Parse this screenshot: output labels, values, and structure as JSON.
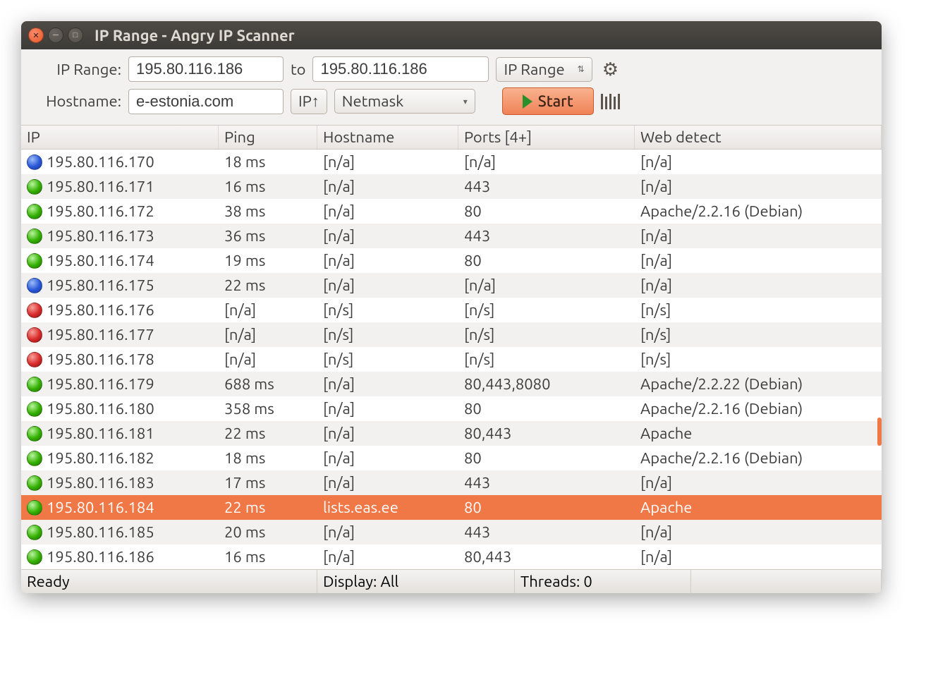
{
  "window": {
    "title": "IP Range - Angry IP Scanner"
  },
  "toolbar": {
    "ip_range_label": "IP Range:",
    "ip_from": "195.80.116.186",
    "to_label": "to",
    "ip_to": "195.80.116.186",
    "mode_select": "IP Range",
    "hostname_label": "Hostname:",
    "hostname": "e-estonia.com",
    "ip_up_label": "IP↑",
    "netmask_select": "Netmask",
    "start_label": "Start"
  },
  "columns": [
    "IP",
    "Ping",
    "Hostname",
    "Ports [4+]",
    "Web detect"
  ],
  "rows": [
    {
      "status": "blue",
      "ip": "195.80.116.170",
      "ping": "18 ms",
      "host": "[n/a]",
      "ports": "[n/a]",
      "web": "[n/a]",
      "selected": false
    },
    {
      "status": "green",
      "ip": "195.80.116.171",
      "ping": "16 ms",
      "host": "[n/a]",
      "ports": "443",
      "web": "[n/a]",
      "selected": false
    },
    {
      "status": "green",
      "ip": "195.80.116.172",
      "ping": "38 ms",
      "host": "[n/a]",
      "ports": "80",
      "web": "Apache/2.2.16 (Debian)",
      "selected": false
    },
    {
      "status": "green",
      "ip": "195.80.116.173",
      "ping": "36 ms",
      "host": "[n/a]",
      "ports": "443",
      "web": "[n/a]",
      "selected": false
    },
    {
      "status": "green",
      "ip": "195.80.116.174",
      "ping": "19 ms",
      "host": "[n/a]",
      "ports": "80",
      "web": "[n/a]",
      "selected": false
    },
    {
      "status": "blue",
      "ip": "195.80.116.175",
      "ping": "22 ms",
      "host": "[n/a]",
      "ports": "[n/a]",
      "web": "[n/a]",
      "selected": false
    },
    {
      "status": "red",
      "ip": "195.80.116.176",
      "ping": "[n/a]",
      "host": "[n/s]",
      "ports": "[n/s]",
      "web": "[n/s]",
      "selected": false
    },
    {
      "status": "red",
      "ip": "195.80.116.177",
      "ping": "[n/a]",
      "host": "[n/s]",
      "ports": "[n/s]",
      "web": "[n/s]",
      "selected": false
    },
    {
      "status": "red",
      "ip": "195.80.116.178",
      "ping": "[n/a]",
      "host": "[n/s]",
      "ports": "[n/s]",
      "web": "[n/s]",
      "selected": false
    },
    {
      "status": "green",
      "ip": "195.80.116.179",
      "ping": "688 ms",
      "host": "[n/a]",
      "ports": "80,443,8080",
      "web": "Apache/2.2.22 (Debian)",
      "selected": false
    },
    {
      "status": "green",
      "ip": "195.80.116.180",
      "ping": "358 ms",
      "host": "[n/a]",
      "ports": "80",
      "web": "Apache/2.2.16 (Debian)",
      "selected": false
    },
    {
      "status": "green",
      "ip": "195.80.116.181",
      "ping": "22 ms",
      "host": "[n/a]",
      "ports": "80,443",
      "web": "Apache",
      "selected": false
    },
    {
      "status": "green",
      "ip": "195.80.116.182",
      "ping": "18 ms",
      "host": "[n/a]",
      "ports": "80",
      "web": "Apache/2.2.16 (Debian)",
      "selected": false
    },
    {
      "status": "green",
      "ip": "195.80.116.183",
      "ping": "17 ms",
      "host": "[n/a]",
      "ports": "443",
      "web": "[n/a]",
      "selected": false
    },
    {
      "status": "green",
      "ip": "195.80.116.184",
      "ping": "22 ms",
      "host": "lists.eas.ee",
      "ports": "80",
      "web": "Apache",
      "selected": true
    },
    {
      "status": "green",
      "ip": "195.80.116.185",
      "ping": "20 ms",
      "host": "[n/a]",
      "ports": "443",
      "web": "[n/a]",
      "selected": false
    },
    {
      "status": "green",
      "ip": "195.80.116.186",
      "ping": "16 ms",
      "host": "[n/a]",
      "ports": "80,443",
      "web": "[n/a]",
      "selected": false
    }
  ],
  "statusbar": {
    "ready": "Ready",
    "display": "Display: All",
    "threads": "Threads: 0"
  }
}
